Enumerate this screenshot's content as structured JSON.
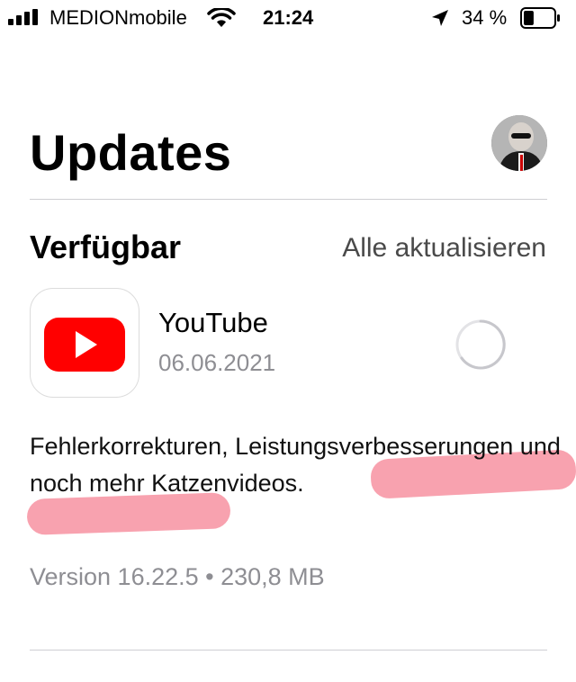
{
  "status_bar": {
    "carrier": "MEDIONmobile",
    "time": "21:24",
    "battery_percent": "34 %",
    "battery_level": 0.34,
    "icons": [
      "signal-icon",
      "wifi-icon",
      "location-arrow-icon",
      "battery-icon"
    ]
  },
  "page": {
    "title": "Updates",
    "avatar": "profile-avatar"
  },
  "section": {
    "title": "Verfügbar",
    "update_all": "Alle aktualisieren"
  },
  "app": {
    "name": "YouTube",
    "date": "06.06.2021",
    "icon": "youtube-icon",
    "state": "loading-spinner",
    "description": "Fehlerkorrekturen, Leistungsverbesserungen und noch mehr Katzenvideos.",
    "version_info": "Version 16.22.5 • 230,8 MB"
  },
  "colors": {
    "accent_red": "#ff0000",
    "highlight": "#f3556e",
    "secondary_text": "#8e8e93"
  }
}
